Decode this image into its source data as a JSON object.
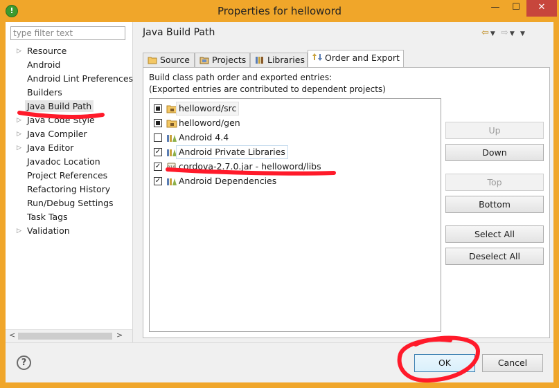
{
  "window": {
    "title": "Properties for helloword",
    "minimize_glyph": "—",
    "maximize_glyph": "☐",
    "close_glyph": "✕",
    "app_icon_glyph": "!"
  },
  "nav": {
    "filter_placeholder": "type filter text",
    "items": [
      {
        "label": "Resource",
        "expandable": true
      },
      {
        "label": "Android",
        "expandable": false
      },
      {
        "label": "Android Lint Preferences",
        "expandable": false
      },
      {
        "label": "Builders",
        "expandable": false
      },
      {
        "label": "Java Build Path",
        "expandable": false,
        "selected": true
      },
      {
        "label": "Java Code Style",
        "expandable": true
      },
      {
        "label": "Java Compiler",
        "expandable": true
      },
      {
        "label": "Java Editor",
        "expandable": true
      },
      {
        "label": "Javadoc Location",
        "expandable": false
      },
      {
        "label": "Project References",
        "expandable": false
      },
      {
        "label": "Refactoring History",
        "expandable": false
      },
      {
        "label": "Run/Debug Settings",
        "expandable": false
      },
      {
        "label": "Task Tags",
        "expandable": false
      },
      {
        "label": "Validation",
        "expandable": true
      }
    ],
    "expand_glyph": "▷",
    "scroll_left_glyph": "<",
    "scroll_right_glyph": ">"
  },
  "main": {
    "page_title": "Java Build Path",
    "history": {
      "back_glyph": "⇦",
      "forward_glyph": "⇨",
      "dropdown_glyph": "▼"
    },
    "tabs": [
      {
        "label": "Source",
        "icon": "source-folder-icon"
      },
      {
        "label": "Projects",
        "icon": "projects-icon"
      },
      {
        "label": "Libraries",
        "icon": "libraries-icon"
      },
      {
        "label": "Order and Export",
        "icon": "order-export-icon",
        "active": true
      }
    ],
    "description": {
      "line1": "Build class path order and exported entries:",
      "line2": "(Exported entries are contributed to dependent projects)"
    },
    "entries": [
      {
        "label": "helloword/src",
        "check": "partial",
        "icon": "source-folder-icon"
      },
      {
        "label": "helloword/gen",
        "check": "partial",
        "icon": "source-folder-icon"
      },
      {
        "label": "Android 4.4",
        "check": "unchecked",
        "icon": "library-icon"
      },
      {
        "label": "Android Private Libraries",
        "check": "checked",
        "icon": "library-icon"
      },
      {
        "label": "cordova-2.7.0.jar - helloword/libs",
        "check": "checked",
        "icon": "jar-icon"
      },
      {
        "label": "Android Dependencies",
        "check": "checked",
        "icon": "library-icon"
      }
    ],
    "check_glyph": "✓",
    "buttons": {
      "up": "Up",
      "down": "Down",
      "top": "Top",
      "bottom": "Bottom",
      "select_all": "Select All",
      "deselect_all": "Deselect All"
    }
  },
  "footer": {
    "help_glyph": "?",
    "ok": "OK",
    "cancel": "Cancel"
  },
  "colors": {
    "title_bar": "#f0a62a",
    "close_button": "#c7463c",
    "annotation_red": "#ff1a2a",
    "accent_blue": "#3c7fb1"
  }
}
